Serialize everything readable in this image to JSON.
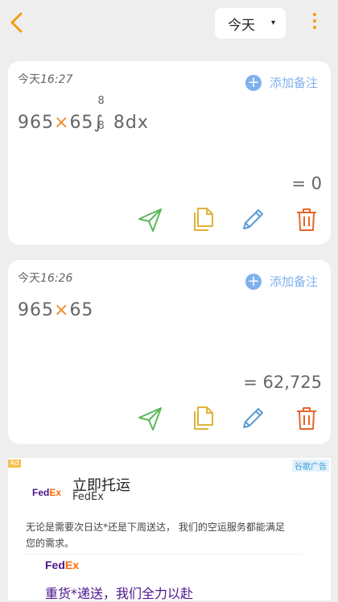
{
  "header": {
    "date_filter": "今天",
    "date_caret": "▾"
  },
  "records": [
    {
      "time_date": "今天",
      "time_hm": "16:27",
      "add_note": "添加备注",
      "expr_a": "965",
      "op": "×",
      "expr_b": "65",
      "integral_sign": "∫",
      "upper": "8",
      "lower": "8",
      "integrand": "8dx",
      "result": "= 0"
    },
    {
      "time_date": "今天",
      "time_hm": "16:26",
      "add_note": "添加备注",
      "expr_a": "965",
      "op": "×",
      "expr_b": "65",
      "result": "= 62,725"
    }
  ],
  "actions": {
    "send_icon": "send-icon",
    "copy_icon": "copy-icon",
    "edit_icon": "pencil-icon",
    "delete_icon": "trash-icon",
    "colors": {
      "send": "#5cb85c",
      "copy": "#e0b23a",
      "edit": "#5b9bd5",
      "delete": "#e8652b"
    }
  },
  "ad": {
    "ad_tag": "Ad",
    "network_tag": "谷歌广告",
    "logo_fe": "Fed",
    "logo_ex": "Ex",
    "title": "立即托运",
    "brand": "FedEx",
    "description": "无论是需要次日达*还是下周送达， 我们的空运服务都能满足您的需求。",
    "promo": "重货*递送，我们全力以赴"
  },
  "colors": {
    "accent": "#f39c12",
    "operator": "#ef8a28",
    "link_blue": "#7fb0ee",
    "background": "#eeeeee"
  }
}
